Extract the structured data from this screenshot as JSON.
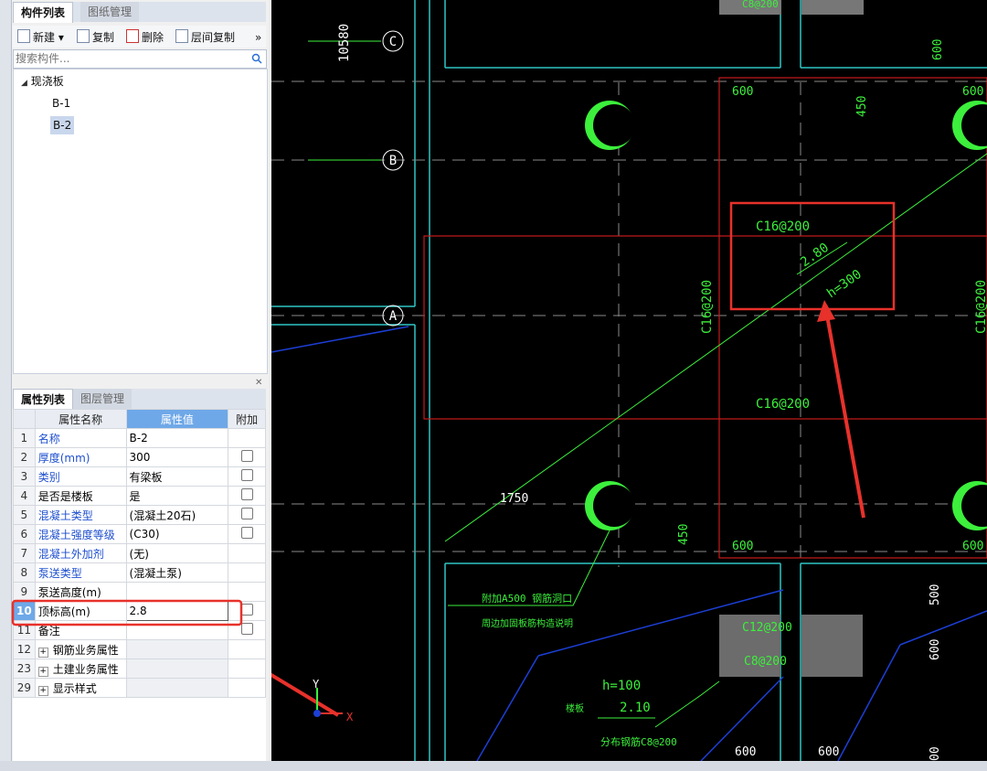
{
  "panel_top": {
    "tabs": [
      "构件列表",
      "图纸管理"
    ]
  },
  "toolbar": {
    "new_label": "新建",
    "copy_label": "复制",
    "delete_label": "删除",
    "floor_copy_label": "层间复制",
    "more": "»"
  },
  "search": {
    "placeholder": "搜索构件..."
  },
  "tree": {
    "root_label": "现浇板",
    "items": [
      "B-1",
      "B-2"
    ],
    "selected": "B-2"
  },
  "panel_bottom": {
    "tabs": [
      "属性列表",
      "图层管理"
    ]
  },
  "props": {
    "headers": [
      "属性名称",
      "属性值",
      "附加"
    ],
    "rows": [
      {
        "idx": "1",
        "name": "名称",
        "value": "B-2"
      },
      {
        "idx": "2",
        "name": "厚度(mm)",
        "value": "300"
      },
      {
        "idx": "3",
        "name": "类别",
        "value": "有梁板"
      },
      {
        "idx": "4",
        "name": "是否是楼板",
        "value": "是"
      },
      {
        "idx": "5",
        "name": "混凝土类型",
        "value": "(混凝土20石)"
      },
      {
        "idx": "6",
        "name": "混凝土强度等级",
        "value": "(C30)"
      },
      {
        "idx": "7",
        "name": "混凝土外加剂",
        "value": "(无)"
      },
      {
        "idx": "8",
        "name": "泵送类型",
        "value": "(混凝土泵)"
      },
      {
        "idx": "9",
        "name": "泵送高度(m)",
        "value": ""
      },
      {
        "idx": "10",
        "name": "顶标高(m)",
        "value": "2.8"
      },
      {
        "idx": "11",
        "name": "备注",
        "value": ""
      },
      {
        "idx": "12",
        "name": "钢筋业务属性",
        "value": ""
      },
      {
        "idx": "23",
        "name": "土建业务属性",
        "value": ""
      },
      {
        "idx": "29",
        "name": "显示样式",
        "value": ""
      }
    ]
  },
  "cad": {
    "axes": [
      "C",
      "B",
      "A"
    ],
    "dims": [
      "10580",
      "600",
      "600",
      "450",
      "600",
      "1750",
      "450",
      "600",
      "600",
      "500",
      "600",
      "600",
      "600",
      "00"
    ],
    "labels": {
      "c16_top": "C16@200",
      "c16_bottom": "C16@200",
      "c16_vertical": "C16@200",
      "c16_right": "C16@200",
      "elev": "2.80",
      "thickness": "h=300",
      "c12": "C12@200",
      "c8a": "C8@200",
      "h100": "h=100",
      "elev2": "2.10",
      "note1": "附加A500 钢筋洞口",
      "note2": "周边加固板筋构造说明",
      "note3": "楼板",
      "note4": "分布钢筋C8@200",
      "top_cut": "C8@200",
      "ucs_y": "Y",
      "ucs_x": "X"
    }
  },
  "colors": {
    "highlight_red": "#e8312b",
    "cad_green": "#3cf03c",
    "cad_cyan": "#2fc6c6",
    "cad_red": "#c81a1a",
    "cad_blue": "#1c3fd6"
  }
}
